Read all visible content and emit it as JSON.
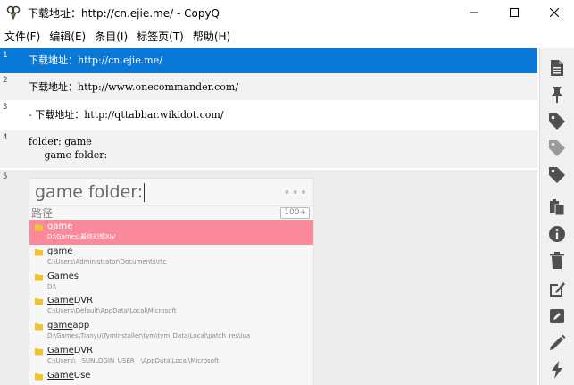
{
  "window": {
    "title": "下载地址：http://cn.ejie.me/ - CopyQ",
    "app_icon": "copyq-icon",
    "controls": [
      "minimize-icon",
      "maximize-icon",
      "close-icon"
    ]
  },
  "menu": [
    {
      "label": "文件(F)"
    },
    {
      "label": "编辑(E)"
    },
    {
      "label": "条目(I)"
    },
    {
      "label": "标签页(T)"
    },
    {
      "label": "帮助(H)"
    }
  ],
  "items": [
    {
      "num": "1",
      "text": "下载地址：http://cn.ejie.me/",
      "selected": true
    },
    {
      "num": "2",
      "text": "下载地址：http://www.onecommander.com/"
    },
    {
      "num": "3",
      "text": "- 下载地址：http://qttabbar.wikidot.com/"
    },
    {
      "num": "4",
      "text": "folder: game\n     game folder:"
    },
    {
      "num": "5",
      "text": ""
    }
  ],
  "popup": {
    "query": "game folder:",
    "dots": "•••",
    "sub_label": "路径",
    "count": "100+",
    "results": [
      {
        "pre": "",
        "match": "game",
        "post": "",
        "path": "D:\\Games\\最终幻想XIV",
        "highlighted": true
      },
      {
        "pre": "",
        "match": "game",
        "post": "",
        "path": "C:\\Users\\Administrator\\Documents\\rtc"
      },
      {
        "pre": "",
        "match": "Game",
        "post": "s",
        "path": "D:\\"
      },
      {
        "pre": "",
        "match": "Game",
        "post": "DVR",
        "path": "C:\\Users\\Default\\AppData\\Local\\Microsoft"
      },
      {
        "pre": "",
        "match": "game",
        "post": "app",
        "path": "D:\\Games\\Tianyu\\TymInstaller\\tym\\tym_Data\\Local\\patch_res\\lua"
      },
      {
        "pre": "",
        "match": "Game",
        "post": "DVR",
        "path": "C:\\Users\\__SUNLOGIN_USER__\\AppData\\Local\\Microsoft"
      },
      {
        "pre": "",
        "match": "Game",
        "post": "Use",
        "path": ""
      }
    ]
  },
  "toolbar": [
    {
      "icon": "show-content-icon"
    },
    {
      "icon": "pin-icon"
    },
    {
      "icon": "tag-important-icon"
    },
    {
      "icon": "tag-light-icon"
    },
    {
      "icon": "tag-icon"
    },
    {
      "icon": "paste-icon"
    },
    {
      "icon": "info-icon"
    },
    {
      "icon": "delete-icon"
    },
    {
      "icon": "edit-external-icon"
    },
    {
      "icon": "edit-icon"
    },
    {
      "icon": "edit-notes-icon"
    },
    {
      "icon": "action-icon"
    }
  ],
  "colors": {
    "selection": "#0a78d7",
    "highlight": "#fa8a9b",
    "icon": "#505050"
  }
}
